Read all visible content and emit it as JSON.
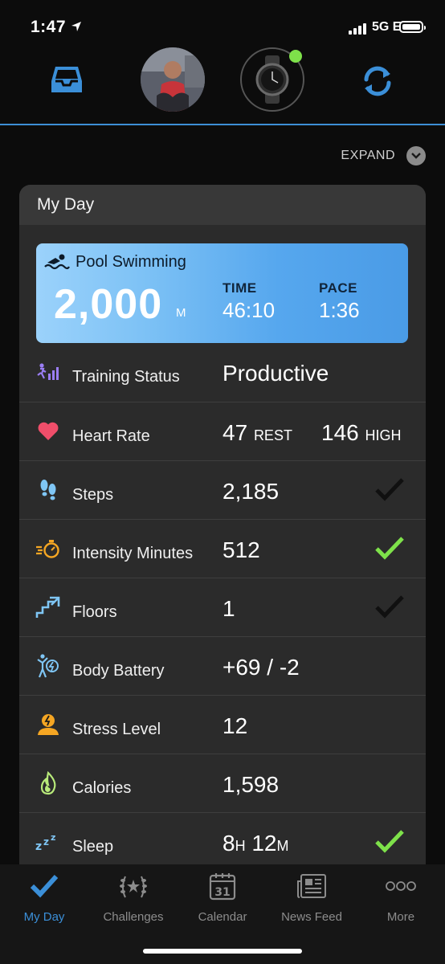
{
  "status_bar": {
    "time": "1:47",
    "network": "5G E"
  },
  "header": {
    "expand_label": "EXPAND"
  },
  "card": {
    "title": "My Day",
    "activity": {
      "name": "Pool Swimming",
      "distance": "2,000",
      "distance_unit": "M",
      "time_label": "TIME",
      "time_value": "46:10",
      "pace_label": "PACE",
      "pace_value": "1:36"
    },
    "rows": [
      {
        "label": "Training Status",
        "value": "Productive",
        "icon": "training-status-icon"
      },
      {
        "label": "Heart Rate",
        "value": "47",
        "unit": "REST",
        "value2": "146",
        "unit2": "HIGH",
        "icon": "heart-icon"
      },
      {
        "label": "Steps",
        "value": "2,185",
        "icon": "footprints-icon",
        "goal_met": false
      },
      {
        "label": "Intensity Minutes",
        "value": "512",
        "icon": "stopwatch-icon",
        "goal_met": true
      },
      {
        "label": "Floors",
        "value": "1",
        "icon": "stairs-icon",
        "goal_met": false
      },
      {
        "label": "Body Battery",
        "value": "+69 / -2",
        "icon": "body-battery-icon"
      },
      {
        "label": "Stress Level",
        "value": "12",
        "icon": "stress-icon"
      },
      {
        "label": "Calories",
        "value": "1,598",
        "icon": "flame-icon"
      },
      {
        "label": "Sleep",
        "hours": "8",
        "hours_unit": "H",
        "minutes": "12",
        "minutes_unit": "M",
        "icon": "sleep-icon",
        "goal_met": true
      }
    ]
  },
  "tabs": [
    {
      "label": "My Day",
      "icon": "checkmark-icon",
      "active": true
    },
    {
      "label": "Challenges",
      "icon": "laurel-icon",
      "active": false
    },
    {
      "label": "Calendar",
      "icon": "calendar-icon",
      "calendar_day": "31",
      "active": false
    },
    {
      "label": "News Feed",
      "icon": "newspaper-icon",
      "active": false
    },
    {
      "label": "More",
      "icon": "more-dots-icon",
      "active": false
    }
  ],
  "colors": {
    "accent_blue": "#3b8fd8",
    "goal_green": "#7ee14a",
    "card_bg": "#2b2b2b",
    "heart_red": "#f04e6a",
    "icon_orange": "#f5a623",
    "icon_purple": "#9b7ef5",
    "icon_lightblue": "#7fc6f5",
    "icon_lime": "#b8ea7a"
  }
}
